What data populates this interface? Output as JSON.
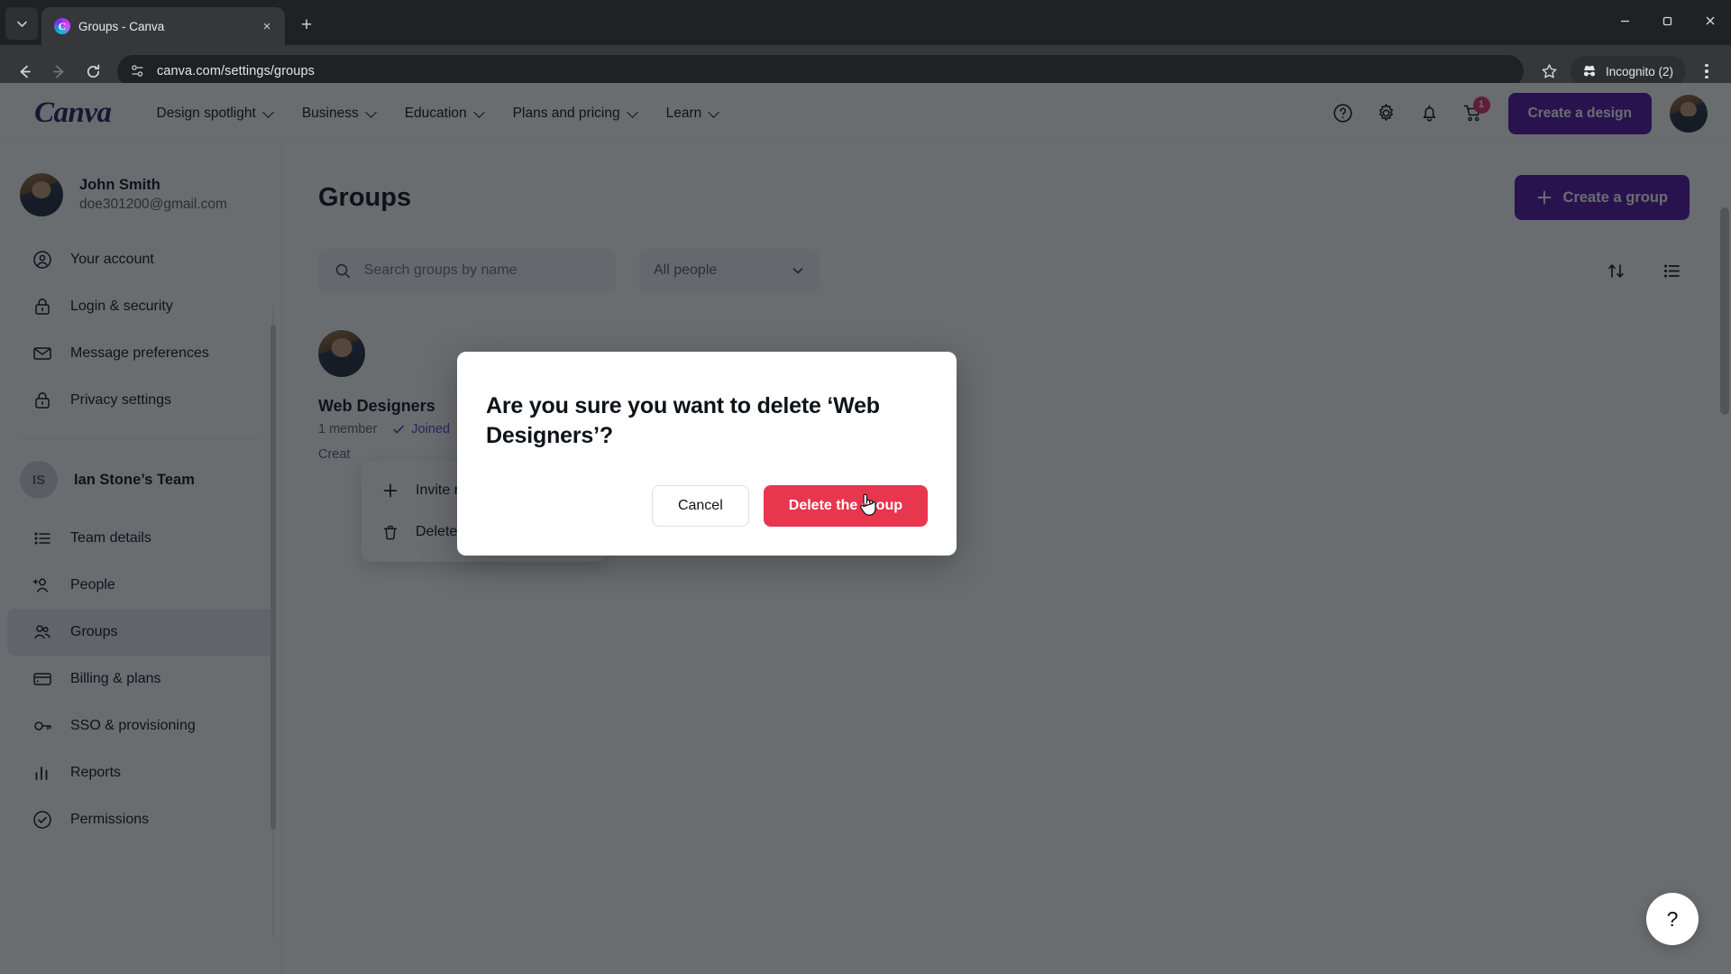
{
  "browser": {
    "tab": {
      "title": "Groups - Canva",
      "favicon": "canva-favicon",
      "close_label": "×"
    },
    "new_tab_label": "+",
    "tab_list_label": "⌄",
    "url": "canva.com/settings/groups",
    "incognito_label": "Incognito (2)",
    "window": {
      "minimize": "–",
      "maximize": "❐",
      "close": "✕"
    }
  },
  "header": {
    "logo": "Canva",
    "nav": [
      {
        "label": "Design spotlight"
      },
      {
        "label": "Business"
      },
      {
        "label": "Education"
      },
      {
        "label": "Plans and pricing"
      },
      {
        "label": "Learn"
      }
    ],
    "help_icon": "help-circle-icon",
    "settings_icon": "gear-icon",
    "notifications_icon": "bell-icon",
    "cart_icon": "shopping-cart-icon",
    "cart_badge": "1",
    "create_design_label": "Create a design",
    "avatar": "user-avatar"
  },
  "sidebar": {
    "user": {
      "name": "John Smith",
      "email": "doe301200@gmail.com"
    },
    "account_items": [
      {
        "label": "Your account",
        "icon": "person-circle-icon"
      },
      {
        "label": "Login & security",
        "icon": "lock-icon"
      },
      {
        "label": "Message preferences",
        "icon": "envelope-icon"
      },
      {
        "label": "Privacy settings",
        "icon": "lock-icon"
      }
    ],
    "team": {
      "initials": "IS",
      "name": "Ian Stone’s Team"
    },
    "team_items": [
      {
        "label": "Team details",
        "icon": "list-icon",
        "active": false
      },
      {
        "label": "People",
        "icon": "add-person-icon",
        "active": false
      },
      {
        "label": "Groups",
        "icon": "people-group-icon",
        "active": true
      },
      {
        "label": "Billing & plans",
        "icon": "credit-card-icon",
        "active": false
      },
      {
        "label": "SSO & provisioning",
        "icon": "key-icon",
        "active": false
      },
      {
        "label": "Reports",
        "icon": "bar-chart-icon",
        "active": false
      },
      {
        "label": "Permissions",
        "icon": "check-shield-icon",
        "active": false
      }
    ]
  },
  "main": {
    "title": "Groups",
    "create_group_label": "Create a group",
    "search": {
      "placeholder": "Search groups by name",
      "value": "",
      "icon": "search-icon"
    },
    "people_filter": {
      "value": "All people",
      "icon": "chevron-down-icon"
    },
    "sort_icon": "sort-arrows-icon",
    "view_icon": "list-view-icon",
    "group": {
      "name": "Web Designers",
      "members": "1 member",
      "joined": "Joined",
      "joined_icon": "check-icon",
      "created": "Creat",
      "kebab_icon": "more-options-icon"
    },
    "dropdown": [
      {
        "label": "Invite members",
        "icon": "plus-icon"
      },
      {
        "label": "Delete group",
        "icon": "trash-icon"
      }
    ],
    "help_fab": "?"
  },
  "modal": {
    "title": "Are you sure you want to delete ‘Web Designers’?",
    "cancel_label": "Cancel",
    "delete_label": "Delete the group",
    "delete_color": "#e8364f",
    "cursor": "hand-pointer-cursor"
  },
  "colors": {
    "brand_purple": "#5314a8",
    "danger_red": "#e8364f",
    "accent_violet": "#5a46c9",
    "badge_pink": "#e1306c"
  }
}
